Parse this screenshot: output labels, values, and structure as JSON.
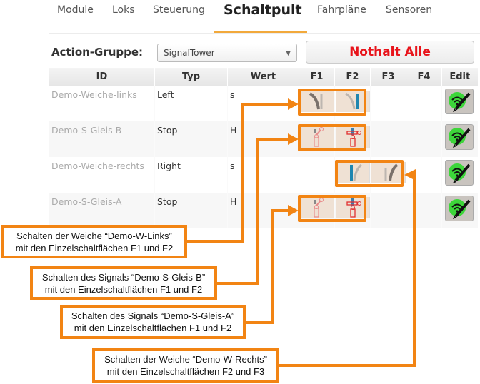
{
  "tabs": [
    {
      "label": "Module",
      "active": false
    },
    {
      "label": "Loks",
      "active": false
    },
    {
      "label": "Steuerung",
      "active": false
    },
    {
      "label": "Schaltpult",
      "active": true
    },
    {
      "label": "Fahrpläne",
      "active": false
    },
    {
      "label": "Sensoren",
      "active": false
    }
  ],
  "action_group": {
    "label": "Action-Gruppe:",
    "selected": "SignalTower"
  },
  "emergency_button": {
    "label": "Nothalt Alle",
    "color": "#e8141b"
  },
  "table": {
    "columns": [
      "ID",
      "Typ",
      "Wert",
      "F1",
      "F2",
      "F3",
      "F4",
      "Edit"
    ],
    "rows": [
      {
        "id": "Demo-Weiche-links",
        "typ": "Left",
        "wert": "s",
        "buttons": {
          "F1": "turnout-left-diverge-icon",
          "F2": "turnout-left-straight-icon"
        }
      },
      {
        "id": "Demo-S-Gleis-B",
        "typ": "Stop",
        "wert": "H",
        "buttons": {
          "F1": "signal-go-icon",
          "F2": "signal-stop-icon"
        }
      },
      {
        "id": "Demo-Weiche-rechts",
        "typ": "Right",
        "wert": "s",
        "buttons": {
          "F2": "turnout-right-straight-icon",
          "F3": "turnout-right-diverge-icon"
        }
      },
      {
        "id": "Demo-S-Gleis-A",
        "typ": "Stop",
        "wert": "H",
        "buttons": {
          "F1": "signal-go-icon",
          "F2": "signal-stop-icon"
        }
      }
    ]
  },
  "callouts": [
    {
      "line1": "Schalten der Weiche “Demo-W-Links”",
      "line2": "mit den Einzelschaltflächen F1 und F2"
    },
    {
      "line1": "Schalten des Signals “Demo-S-Gleis-B”",
      "line2": "mit den Einzelschaltflächen F1 und F2"
    },
    {
      "line1": "Schalten des Signals “Demo-S-Gleis-A”",
      "line2": "mit den Einzelschaltflächen F1 und F2"
    },
    {
      "line1": "Schalten der Weiche “Demo-W-Rechts”",
      "line2": "mit den Einzelschaltflächen F2 und F3"
    }
  ],
  "colors": {
    "accent": "#f28413",
    "tab_underline": "#f2a93b"
  }
}
